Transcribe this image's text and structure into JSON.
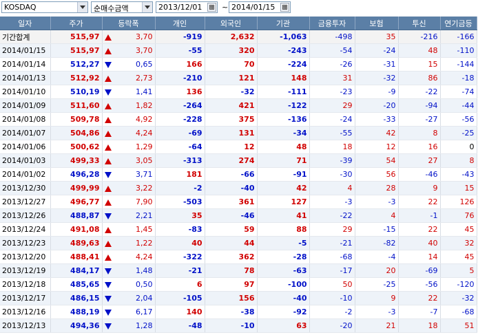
{
  "toolbar": {
    "market": "KOSDAQ",
    "metric": "순매수금액",
    "start_date": "2013/12/01",
    "end_date": "2014/01/15",
    "separator": "~"
  },
  "table": {
    "headers": [
      "일자",
      "주가",
      "등락폭",
      "개인",
      "외국인",
      "기관",
      "금융투자",
      "보험",
      "투신",
      "연기금등"
    ],
    "total": {
      "date": "기간합계",
      "price": "515,97",
      "dir": "up",
      "change": "3,70",
      "individual": "-919",
      "foreign": "2,632",
      "institution": "-1,063",
      "fin_invest": "-498",
      "insurance": "35",
      "trust": "-216",
      "pension": "-166"
    },
    "rows": [
      {
        "date": "2014/01/15",
        "price": "515,97",
        "dir": "up",
        "change": "3,70",
        "individual": "-55",
        "foreign": "320",
        "institution": "-243",
        "fin_invest": "-54",
        "insurance": "-24",
        "trust": "48",
        "pension": "-110"
      },
      {
        "date": "2014/01/14",
        "price": "512,27",
        "dir": "down",
        "change": "0,65",
        "individual": "166",
        "foreign": "70",
        "institution": "-224",
        "fin_invest": "-26",
        "insurance": "-31",
        "trust": "15",
        "pension": "-144"
      },
      {
        "date": "2014/01/13",
        "price": "512,92",
        "dir": "up",
        "change": "2,73",
        "individual": "-210",
        "foreign": "121",
        "institution": "148",
        "fin_invest": "31",
        "insurance": "-32",
        "trust": "86",
        "pension": "-18"
      },
      {
        "date": "2014/01/10",
        "price": "510,19",
        "dir": "down",
        "change": "1,41",
        "individual": "136",
        "foreign": "-32",
        "institution": "-111",
        "fin_invest": "-23",
        "insurance": "-9",
        "trust": "-22",
        "pension": "-74"
      },
      {
        "date": "2014/01/09",
        "price": "511,60",
        "dir": "up",
        "change": "1,82",
        "individual": "-264",
        "foreign": "421",
        "institution": "-122",
        "fin_invest": "29",
        "insurance": "-20",
        "trust": "-94",
        "pension": "-44"
      },
      {
        "date": "2014/01/08",
        "price": "509,78",
        "dir": "up",
        "change": "4,92",
        "individual": "-228",
        "foreign": "375",
        "institution": "-136",
        "fin_invest": "-24",
        "insurance": "-33",
        "trust": "-27",
        "pension": "-56"
      },
      {
        "date": "2014/01/07",
        "price": "504,86",
        "dir": "up",
        "change": "4,24",
        "individual": "-69",
        "foreign": "131",
        "institution": "-34",
        "fin_invest": "-55",
        "insurance": "42",
        "trust": "8",
        "pension": "-25"
      },
      {
        "date": "2014/01/06",
        "price": "500,62",
        "dir": "up",
        "change": "1,29",
        "individual": "-64",
        "foreign": "12",
        "institution": "48",
        "fin_invest": "18",
        "insurance": "12",
        "trust": "16",
        "pension": "0"
      },
      {
        "date": "2014/01/03",
        "price": "499,33",
        "dir": "up",
        "change": "3,05",
        "individual": "-313",
        "foreign": "274",
        "institution": "71",
        "fin_invest": "-39",
        "insurance": "54",
        "trust": "27",
        "pension": "8"
      },
      {
        "date": "2014/01/02",
        "price": "496,28",
        "dir": "down",
        "change": "3,71",
        "individual": "181",
        "foreign": "-66",
        "institution": "-91",
        "fin_invest": "-30",
        "insurance": "56",
        "trust": "-46",
        "pension": "-43"
      },
      {
        "date": "2013/12/30",
        "price": "499,99",
        "dir": "up",
        "change": "3,22",
        "individual": "-2",
        "foreign": "-40",
        "institution": "42",
        "fin_invest": "4",
        "insurance": "28",
        "trust": "9",
        "pension": "15"
      },
      {
        "date": "2013/12/27",
        "price": "496,77",
        "dir": "up",
        "change": "7,90",
        "individual": "-503",
        "foreign": "361",
        "institution": "127",
        "fin_invest": "-3",
        "insurance": "-3",
        "trust": "22",
        "pension": "126"
      },
      {
        "date": "2013/12/26",
        "price": "488,87",
        "dir": "down",
        "change": "2,21",
        "individual": "35",
        "foreign": "-46",
        "institution": "41",
        "fin_invest": "-22",
        "insurance": "4",
        "trust": "-1",
        "pension": "76"
      },
      {
        "date": "2013/12/24",
        "price": "491,08",
        "dir": "up",
        "change": "1,45",
        "individual": "-83",
        "foreign": "59",
        "institution": "88",
        "fin_invest": "29",
        "insurance": "-15",
        "trust": "22",
        "pension": "45"
      },
      {
        "date": "2013/12/23",
        "price": "489,63",
        "dir": "up",
        "change": "1,22",
        "individual": "40",
        "foreign": "44",
        "institution": "-5",
        "fin_invest": "-21",
        "insurance": "-82",
        "trust": "40",
        "pension": "32"
      },
      {
        "date": "2013/12/20",
        "price": "488,41",
        "dir": "up",
        "change": "4,24",
        "individual": "-322",
        "foreign": "362",
        "institution": "-28",
        "fin_invest": "-68",
        "insurance": "-4",
        "trust": "14",
        "pension": "45"
      },
      {
        "date": "2013/12/19",
        "price": "484,17",
        "dir": "down",
        "change": "1,48",
        "individual": "-21",
        "foreign": "78",
        "institution": "-63",
        "fin_invest": "-17",
        "insurance": "20",
        "trust": "-69",
        "pension": "5"
      },
      {
        "date": "2013/12/18",
        "price": "485,65",
        "dir": "down",
        "change": "0,50",
        "individual": "6",
        "foreign": "97",
        "institution": "-100",
        "fin_invest": "50",
        "insurance": "-25",
        "trust": "-56",
        "pension": "-120"
      },
      {
        "date": "2013/12/17",
        "price": "486,15",
        "dir": "down",
        "change": "2,04",
        "individual": "-105",
        "foreign": "156",
        "institution": "-40",
        "fin_invest": "-10",
        "insurance": "9",
        "trust": "22",
        "pension": "-32"
      },
      {
        "date": "2013/12/16",
        "price": "488,19",
        "dir": "down",
        "change": "6,17",
        "individual": "140",
        "foreign": "-38",
        "institution": "-92",
        "fin_invest": "-2",
        "insurance": "-3",
        "trust": "-7",
        "pension": "-68"
      },
      {
        "date": "2013/12/13",
        "price": "494,36",
        "dir": "down",
        "change": "1,28",
        "individual": "-48",
        "foreign": "-10",
        "institution": "63",
        "fin_invest": "-20",
        "insurance": "21",
        "trust": "18",
        "pension": "51"
      }
    ]
  },
  "colors": {
    "header_bg": "#5b7fa6",
    "up": "#d10000",
    "down": "#0010c8",
    "row_alt": "#eef3f9"
  }
}
